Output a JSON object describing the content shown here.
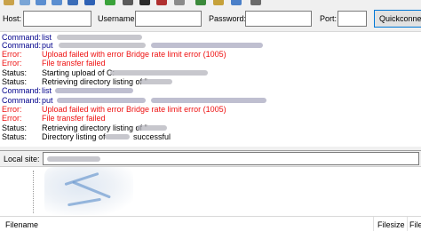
{
  "quickconnect": {
    "host_label": "Host:",
    "username_label": "Username:",
    "password_label": "Password:",
    "port_label": "Port:",
    "quickconnect_label": "Quickconnect"
  },
  "log": [
    {
      "type": "Command:",
      "message": "list",
      "kind": "command"
    },
    {
      "type": "Command:",
      "message": "put",
      "kind": "command"
    },
    {
      "type": "Error:",
      "message": "Upload failed with error Bridge rate limit error (1005)",
      "kind": "error"
    },
    {
      "type": "Error:",
      "message": "File transfer failed",
      "kind": "error"
    },
    {
      "type": "Status:",
      "message": "Starting upload of C:",
      "kind": "status"
    },
    {
      "type": "Status:",
      "message": "Retrieving directory listing of \"",
      "kind": "status"
    },
    {
      "type": "Command:",
      "message": "list",
      "kind": "command"
    },
    {
      "type": "Command:",
      "message": "put",
      "kind": "command"
    },
    {
      "type": "Error:",
      "message": "Upload failed with error Bridge rate limit error (1005)",
      "kind": "error"
    },
    {
      "type": "Error:",
      "message": "File transfer failed",
      "kind": "error"
    },
    {
      "type": "Status:",
      "message": "Retrieving directory listing of \"",
      "kind": "status"
    },
    {
      "type": "Status:",
      "message": "Directory listing of",
      "suffix": "successful",
      "kind": "status"
    }
  ],
  "local_site": {
    "label": "Local site:"
  },
  "file_list": {
    "columns": [
      "Filename",
      "Filesize",
      "File"
    ]
  },
  "colors": {
    "command": "#00008b",
    "error": "#ee1111",
    "status": "#000000",
    "accent": "#0078d7"
  }
}
